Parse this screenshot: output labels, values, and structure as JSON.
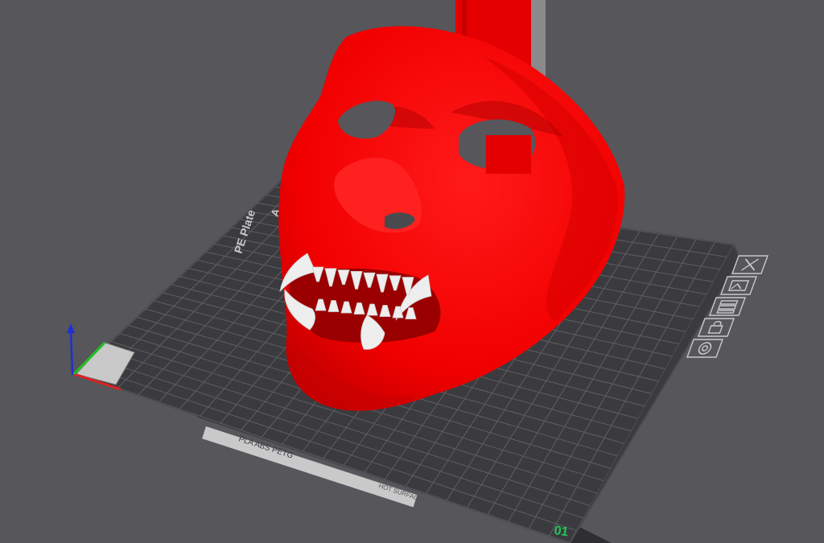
{
  "viewport": {
    "background": "#56565b",
    "model_color": "#ff0000",
    "teeth_color": "#eeeeee",
    "bed_color": "#3a3a3e",
    "grid_color": "#5e5e63"
  },
  "bed": {
    "plate_label": "PE Plate",
    "plate_label_prefix": "A",
    "plate_type_text": "PLA ABS PETG",
    "hot_surface_text": "HOT SURFACE",
    "plate_number": "01"
  },
  "plate_toolbar": {
    "items": [
      {
        "icon": "close-icon",
        "label": "Remove plate"
      },
      {
        "icon": "image-icon",
        "label": "Plate preview"
      },
      {
        "icon": "arrange-icon",
        "label": "Arrange"
      },
      {
        "icon": "lock-icon",
        "label": "Lock plate"
      },
      {
        "icon": "settings-icon",
        "label": "Plate settings"
      }
    ]
  },
  "axes": {
    "x_color": "#e02020",
    "y_color": "#20c020",
    "z_color": "#2030d0"
  }
}
